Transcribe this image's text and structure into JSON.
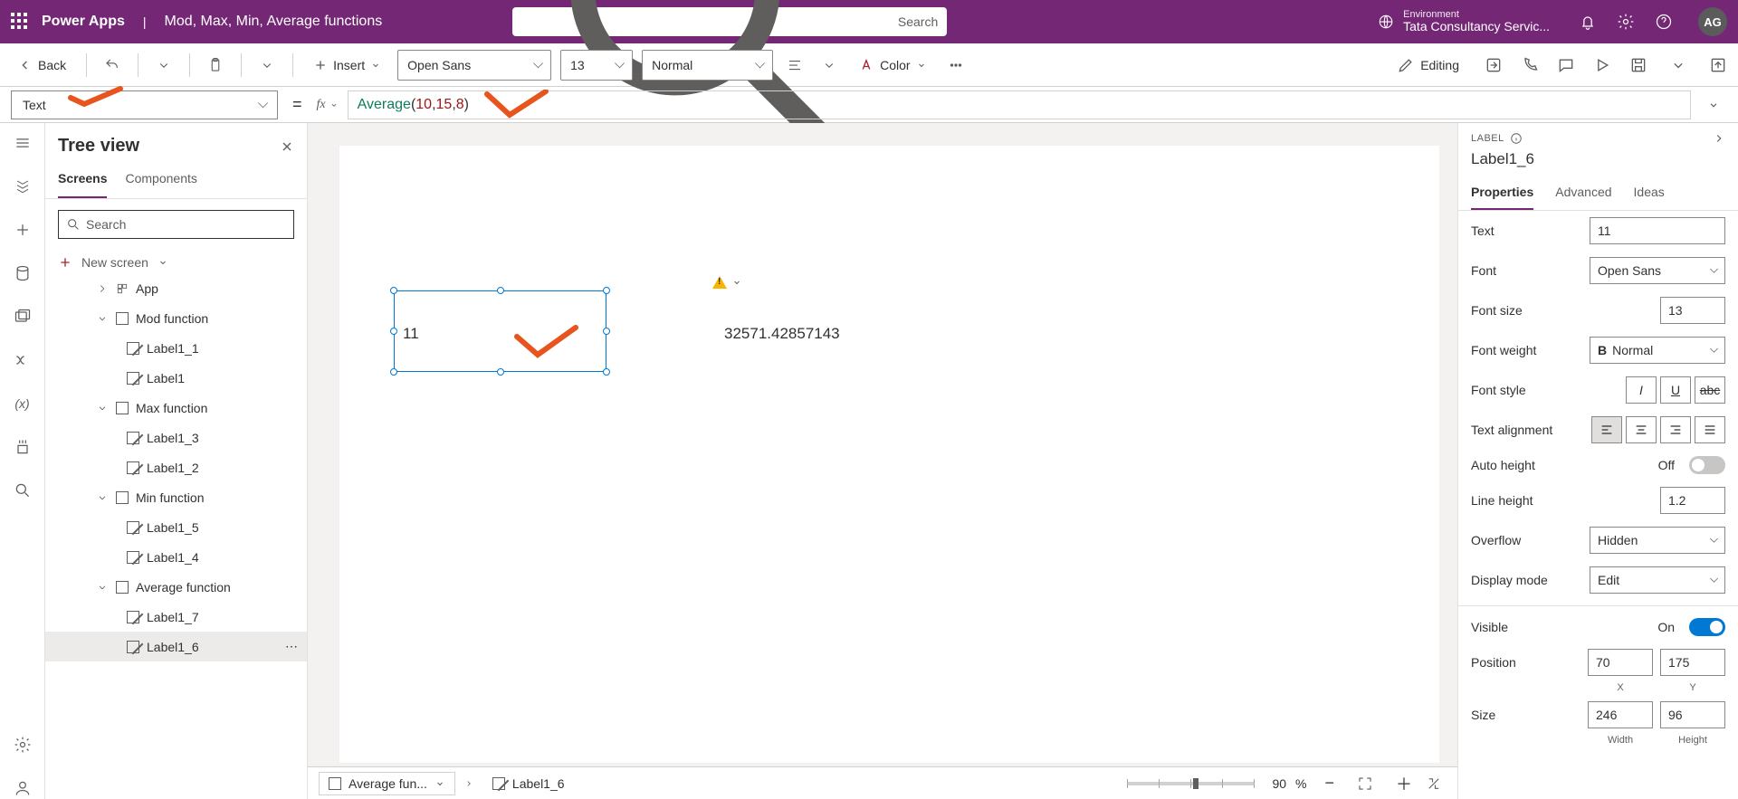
{
  "header": {
    "appName": "Power Apps",
    "pageTitle": "Mod, Max, Min, Average functions",
    "searchPlaceholder": "Search",
    "envLabel": "Environment",
    "envValue": "Tata Consultancy Servic...",
    "avatar": "AG"
  },
  "ribbon": {
    "back": "Back",
    "insert": "Insert",
    "fontFamily": "Open Sans",
    "fontSize": "13",
    "fontWeight": "Normal",
    "color": "Color",
    "editing": "Editing"
  },
  "formulabar": {
    "property": "Text",
    "fx": "fx",
    "formula_fn": "Average",
    "formula_args": [
      "10",
      "15",
      "8"
    ]
  },
  "tree": {
    "title": "Tree view",
    "tabs": {
      "screens": "Screens",
      "components": "Components"
    },
    "searchPlaceholder": "Search",
    "newScreen": "New screen",
    "nodes": {
      "app": "App",
      "mod": "Mod function",
      "mod_c": [
        "Label1_1",
        "Label1"
      ],
      "max": "Max function",
      "max_c": [
        "Label1_3",
        "Label1_2"
      ],
      "min": "Min function",
      "min_c": [
        "Label1_5",
        "Label1_4"
      ],
      "avg": "Average function",
      "avg_c": [
        "Label1_7",
        "Label1_6"
      ]
    }
  },
  "canvas": {
    "selectedValue": "11",
    "otherValue": "32571.42857143"
  },
  "breadcrumb": {
    "screen": "Average fun...",
    "control": "Label1_6"
  },
  "zoom": {
    "value": "90",
    "suffix": "%"
  },
  "props": {
    "kind": "LABEL",
    "name": "Label1_6",
    "tabs": {
      "properties": "Properties",
      "advanced": "Advanced",
      "ideas": "Ideas"
    },
    "text": {
      "label": "Text",
      "value": "11"
    },
    "font": {
      "label": "Font",
      "value": "Open Sans"
    },
    "fontSize": {
      "label": "Font size",
      "value": "13"
    },
    "fontWeight": {
      "label": "Font weight",
      "value": "Normal",
      "prefix": "B"
    },
    "fontStyle": {
      "label": "Font style"
    },
    "textAlign": {
      "label": "Text alignment"
    },
    "autoHeight": {
      "label": "Auto height",
      "state": "Off"
    },
    "lineHeight": {
      "label": "Line height",
      "value": "1.2"
    },
    "overflow": {
      "label": "Overflow",
      "value": "Hidden"
    },
    "displayMode": {
      "label": "Display mode",
      "value": "Edit"
    },
    "visible": {
      "label": "Visible",
      "state": "On"
    },
    "position": {
      "label": "Position",
      "x": "70",
      "y": "175",
      "xl": "X",
      "yl": "Y"
    },
    "size": {
      "label": "Size",
      "w": "246",
      "h": "96",
      "wl": "Width",
      "hl": "Height"
    }
  }
}
